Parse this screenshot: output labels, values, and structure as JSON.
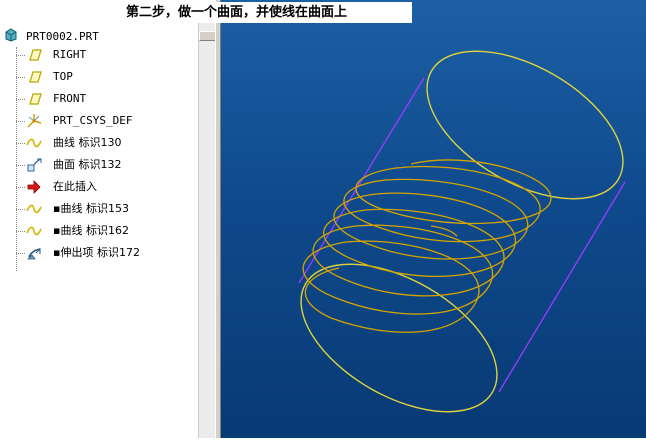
{
  "caption": "第二步，做一个曲面，并使线在曲面上",
  "model_tree": {
    "root": "PRT0002.PRT",
    "items": [
      {
        "label": "RIGHT",
        "icon": "datum-plane-icon",
        "mono": true
      },
      {
        "label": "TOP",
        "icon": "datum-plane-icon",
        "mono": true
      },
      {
        "label": "FRONT",
        "icon": "datum-plane-icon",
        "mono": true
      },
      {
        "label": "PRT_CSYS_DEF",
        "icon": "coordinate-system-icon",
        "mono": true
      },
      {
        "label": "曲线 标识130",
        "icon": "datum-curve-icon",
        "mono": false
      },
      {
        "label": "曲面 标识132",
        "icon": "surface-icon",
        "mono": false
      },
      {
        "label": "在此插入",
        "icon": "insert-here-arrow-icon",
        "mono": false
      },
      {
        "label": "▪曲线 标识153",
        "icon": "datum-curve-icon",
        "mono": false
      },
      {
        "label": "▪曲线 标识162",
        "icon": "datum-curve-icon",
        "mono": false
      },
      {
        "label": "▪伸出项 标识172",
        "icon": "protrusion-icon",
        "mono": false
      }
    ]
  },
  "colors": {
    "plane_icon": "#c8b800",
    "curve": "#e0c800",
    "helix": "#d4a400",
    "surface_edge": "#9a3cff",
    "background_top": "#1d5fa5",
    "background_bottom": "#083a74"
  }
}
